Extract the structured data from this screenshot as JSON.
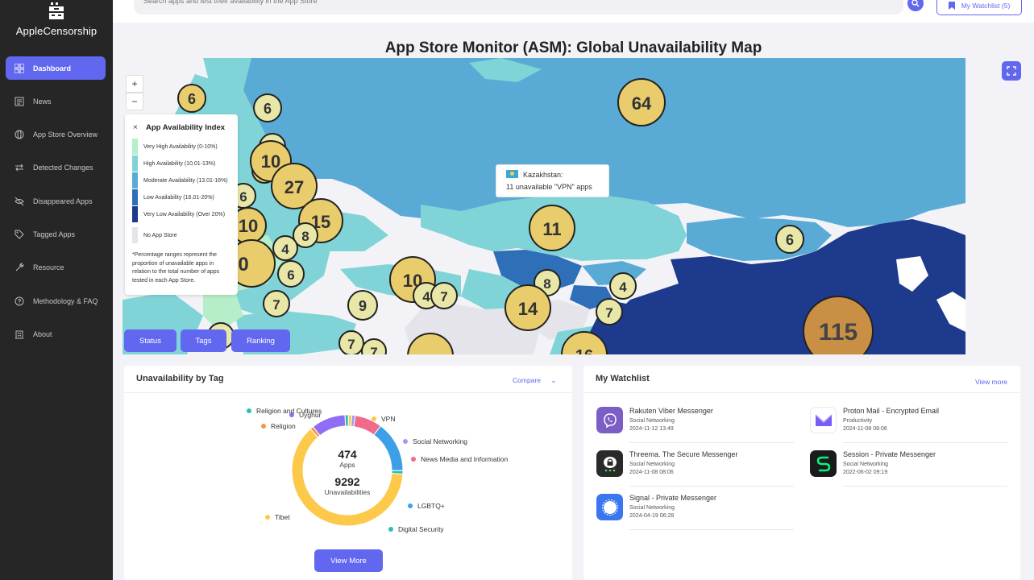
{
  "brand": {
    "name": "AppleCensorship"
  },
  "sidebar": {
    "items": [
      {
        "label": "Dashboard",
        "icon": "grid-icon",
        "active": true
      },
      {
        "label": "News",
        "icon": "newspaper-icon"
      },
      {
        "label": "App Store Overview",
        "icon": "globe-icon"
      },
      {
        "label": "Detected Changes",
        "icon": "arrows-icon"
      },
      {
        "label": "Disappeared Apps",
        "icon": "eye-off-icon"
      },
      {
        "label": "Tagged Apps",
        "icon": "tag-icon"
      },
      {
        "label": "Resource",
        "icon": "tool-icon"
      },
      {
        "label": "Methodology & FAQ",
        "icon": "help-icon"
      },
      {
        "label": "About",
        "icon": "building-icon"
      }
    ]
  },
  "topbar": {
    "search_placeholder": "Search apps and test their availability in the App Store",
    "watchlist_button": "My Watchlist (5)"
  },
  "map": {
    "title": "App Store Monitor (ASM): Global Unavailability Map",
    "zoom_in": "+",
    "zoom_out": "−",
    "legend": {
      "close": "×",
      "title": "App Availability Index",
      "items": [
        {
          "label": "Very High Availability (0-10%)",
          "color": "#b5eec8"
        },
        {
          "label": "High Availability (10.01-13%)",
          "color": "#80d4d8"
        },
        {
          "label": "Moderate Availability (13.01-16%)",
          "color": "#5aaad6"
        },
        {
          "label": "Low Availability (16.01-20%)",
          "color": "#2f6fb8"
        },
        {
          "label": "Very Low Availability (Over 20%)",
          "color": "#1d3a8c"
        },
        {
          "label": "No App Store",
          "color": "#e4e4ea"
        }
      ],
      "note": "*Percentage ranges represent the proportion of unavailable apps in relation to the total number of apps tested in each App Store."
    },
    "tooltip": {
      "country": "Kazakhstan:",
      "text": "11 unavailable \"VPN\" apps"
    },
    "bubbles": [
      "6",
      "6",
      "64",
      "8",
      "6",
      "10",
      "27",
      "6",
      "15",
      "10",
      "8",
      "4",
      "0",
      "6",
      "7",
      "10",
      "4",
      "7",
      "11",
      "6",
      "9",
      "8",
      "4",
      "14",
      "7",
      "115",
      "7",
      "7",
      "16"
    ],
    "tabs": [
      "Status",
      "Tags",
      "Ranking"
    ]
  },
  "unavailability": {
    "title": "Unavailability by Tag",
    "compare": "Compare",
    "center_apps_value": "474",
    "center_apps_label": "Apps",
    "center_unavail_value": "9292",
    "center_unavail_label": "Unavailabilities",
    "view_more": "View More",
    "chart_data": {
      "type": "pie",
      "donut": true,
      "title": "Unavailability by Tag",
      "categories": [
        "VPN",
        "Social Networking",
        "News Media and Information",
        "LGBTQ+",
        "Digital Security",
        "Tibet",
        "Religion",
        "Uyghur",
        "Religion and Cultures"
      ],
      "values": [
        1,
        1,
        8,
        15,
        1,
        63,
        1,
        10,
        1
      ],
      "colors": [
        "#fdc94a",
        "#9c9cf5",
        "#f06b8a",
        "#3da0e6",
        "#2dbdb3",
        "#fdc94a",
        "#f2964b",
        "#8f6ef5",
        "#2dbdb3"
      ]
    }
  },
  "watchlist": {
    "title": "My Watchlist",
    "view_more": "View more",
    "items": [
      {
        "name": "Rakuten Viber Messenger",
        "category": "Social Networking",
        "date": "2024-11-12 13:49",
        "icon": "viber-icon",
        "color": "#7b5fc6"
      },
      {
        "name": "Proton Mail - Encrypted Email",
        "category": "Productivity",
        "date": "2024-11-08 08:06",
        "icon": "proton-icon",
        "color": "#ffffff"
      },
      {
        "name": "Threema. The Secure Messenger",
        "category": "Social Networking",
        "date": "2024-11-08 08:06",
        "icon": "threema-icon",
        "color": "#2a2a2a"
      },
      {
        "name": "Session - Private Messenger",
        "category": "Social Networking",
        "date": "2022-06-02 09:19",
        "icon": "session-icon",
        "color": "#1b1b1b"
      },
      {
        "name": "Signal - Private Messenger",
        "category": "Social Networking",
        "date": "2024-04-19 06:28",
        "icon": "signal-icon",
        "color": "#3a76f0"
      }
    ]
  }
}
